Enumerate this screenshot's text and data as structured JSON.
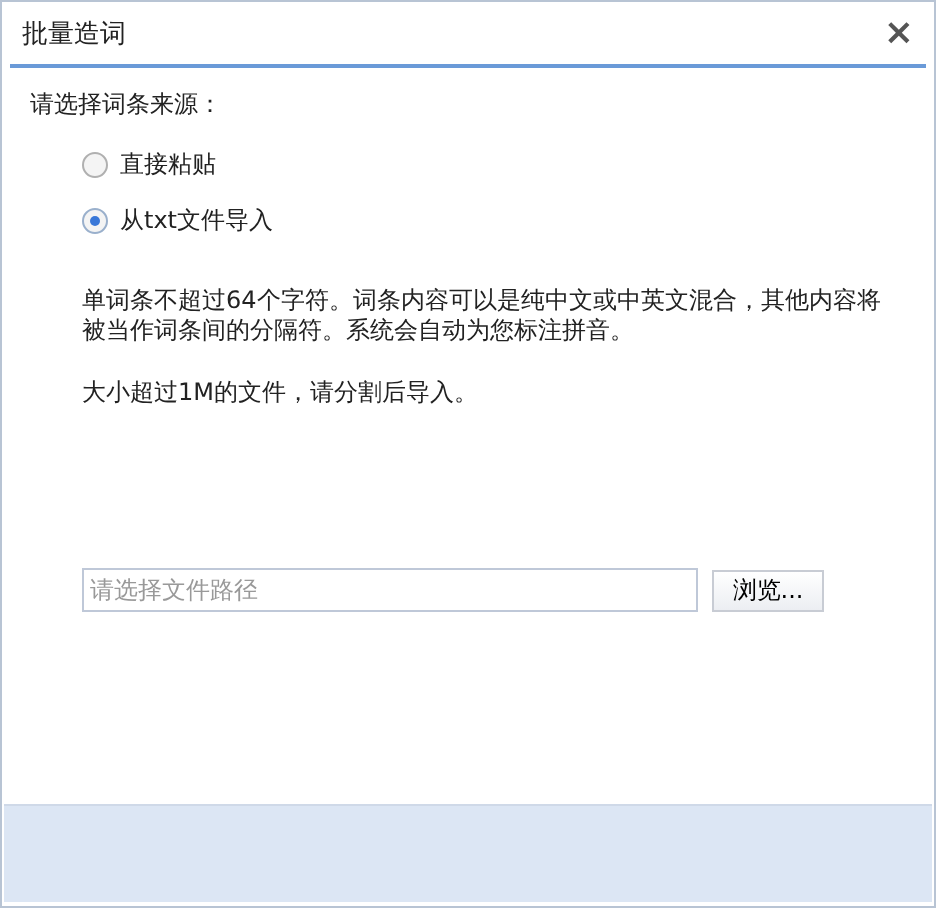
{
  "window": {
    "title": "批量造词",
    "close": "×"
  },
  "prompt": "请选择词条来源：",
  "sources": [
    {
      "label": "直接粘贴",
      "selected": false
    },
    {
      "label": "从txt文件导入",
      "selected": true
    }
  ],
  "notes": [
    "单词条不超过64个字符。词条内容可以是纯中文或中英文混合，其他内容将被当作词条间的分隔符。系统会自动为您标注拼音。",
    "大小超过1M的文件，请分割后导入。"
  ],
  "file_field": {
    "placeholder": "请选择文件路径"
  },
  "browse_button": "浏览..."
}
